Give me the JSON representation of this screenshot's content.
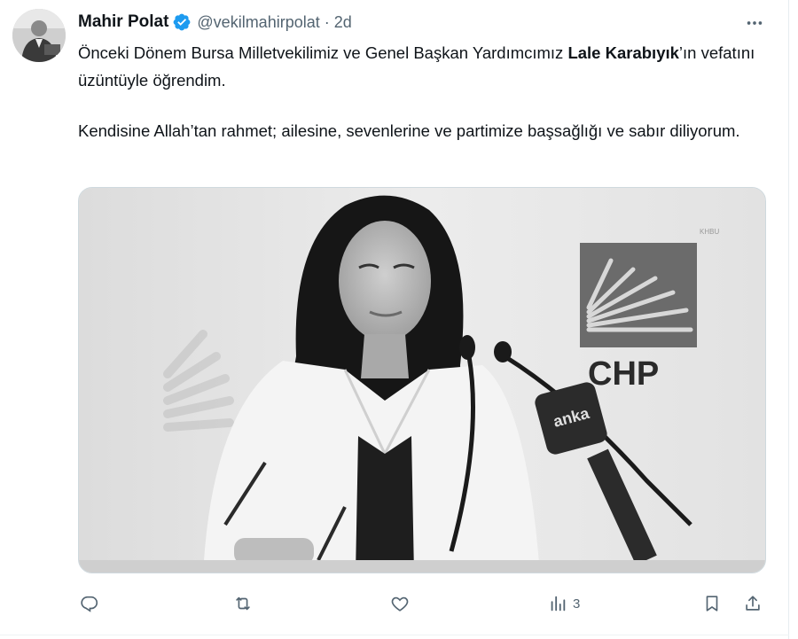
{
  "tweet": {
    "author_name": "Mahir Polat",
    "handle": "@vekilmahirpolat",
    "separator": "·",
    "time": "2d",
    "text_line1_a": "Önceki Dönem Bursa Milletvekilimiz ve Genel Başkan Yardımcımız ",
    "text_line1_bold": "Lale Karabıyık",
    "text_line1_b": "’ın vefatını üzüntüyle öğrendim.",
    "text_para2": "Kendisine Allah’tan rahmet; ailesine, sevenlerine ve partimize başsağlığı ve sabır diliyorum."
  },
  "media": {
    "sign_text": "CHP",
    "mic_label": "anka",
    "watermark": "KHBU"
  },
  "actions": {
    "reply_count": "",
    "retweet_count": "",
    "like_count": "",
    "views_count": "3"
  },
  "colors": {
    "verified_badge": "#1d9bf0",
    "icon_gray": "#536471",
    "text": "#0f1419"
  },
  "icons": {
    "more": "more-icon",
    "reply": "reply-icon",
    "retweet": "retweet-icon",
    "like": "heart-icon",
    "views": "views-icon",
    "bookmark": "bookmark-icon",
    "share": "share-icon"
  }
}
